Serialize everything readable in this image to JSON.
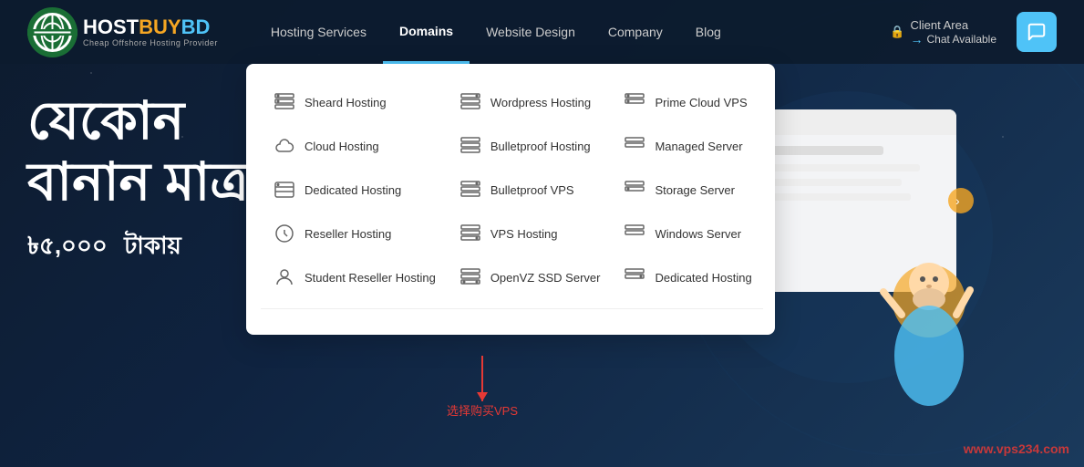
{
  "logo": {
    "text_host": "HOST",
    "text_buy": "BUY",
    "text_bd": "BD",
    "tagline": "Cheap Offshore Hosting Provider"
  },
  "nav": {
    "items": [
      {
        "id": "hosting-services",
        "label": "Hosting Services",
        "active": false
      },
      {
        "id": "domains",
        "label": "Domains",
        "active": true
      },
      {
        "id": "website-design",
        "label": "Website Design",
        "active": false
      },
      {
        "id": "company",
        "label": "Company",
        "active": false
      },
      {
        "id": "blog",
        "label": "Blog",
        "active": false
      }
    ],
    "client_area": "Client Area",
    "chat_available": "Chat Available",
    "chat_arrow": "→"
  },
  "dropdown": {
    "col1": [
      {
        "id": "shared-hosting",
        "label": "Sheard Hosting"
      },
      {
        "id": "cloud-hosting",
        "label": "Cloud Hosting"
      },
      {
        "id": "dedicated-hosting",
        "label": "Dedicated Hosting"
      },
      {
        "id": "reseller-hosting",
        "label": "Reseller Hosting"
      },
      {
        "id": "student-reseller",
        "label": "Student Reseller Hosting"
      }
    ],
    "col2": [
      {
        "id": "wordpress-hosting",
        "label": "Wordpress Hosting"
      },
      {
        "id": "bulletproof-hosting",
        "label": "Bulletproof Hosting"
      },
      {
        "id": "bulletproof-vps",
        "label": "Bulletproof VPS"
      },
      {
        "id": "vps-hosting",
        "label": "VPS Hosting"
      },
      {
        "id": "openvz-ssd",
        "label": "OpenVZ SSD Server"
      }
    ],
    "col3": [
      {
        "id": "prime-cloud-vps",
        "label": "Prime Cloud VPS"
      },
      {
        "id": "managed-server",
        "label": "Managed Server"
      },
      {
        "id": "storage-server",
        "label": "Storage Server"
      },
      {
        "id": "windows-server",
        "label": "Windows Server"
      },
      {
        "id": "dedicated-hosting2",
        "label": "Dedicated Hosting"
      }
    ]
  },
  "hero": {
    "headline_line1": "যেকোন",
    "headline_line2": "বানান মাত্র",
    "price_prefix": "৳৫,০০০",
    "price_suffix": "টাকায়"
  },
  "annotation": {
    "text": "选择购买VPS"
  },
  "watermark": {
    "text": "www.vps234.com"
  }
}
